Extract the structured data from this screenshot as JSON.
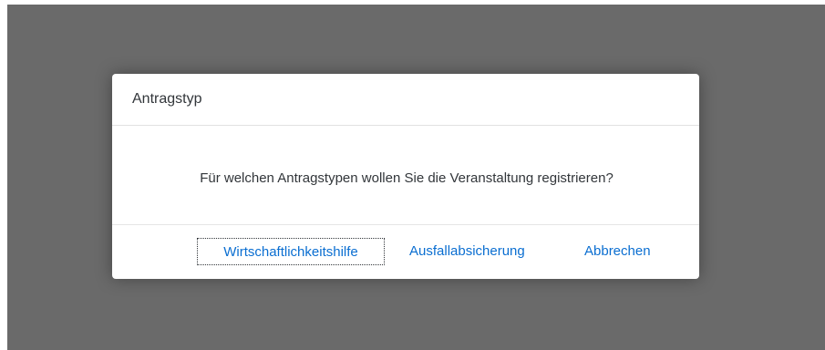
{
  "dialog": {
    "title": "Antragstyp",
    "message": "Für welchen Antragstypen wollen Sie die Veranstaltung registrieren?",
    "buttons": {
      "economic_aid": "Wirtschaftlichkeitshilfe",
      "default_insurance": "Ausfallabsicherung",
      "cancel": "Abbrechen"
    }
  },
  "colors": {
    "overlay": "#6a6a6a",
    "dialog_background": "#ffffff",
    "text": "#32363a",
    "link": "#0a6ed1"
  }
}
